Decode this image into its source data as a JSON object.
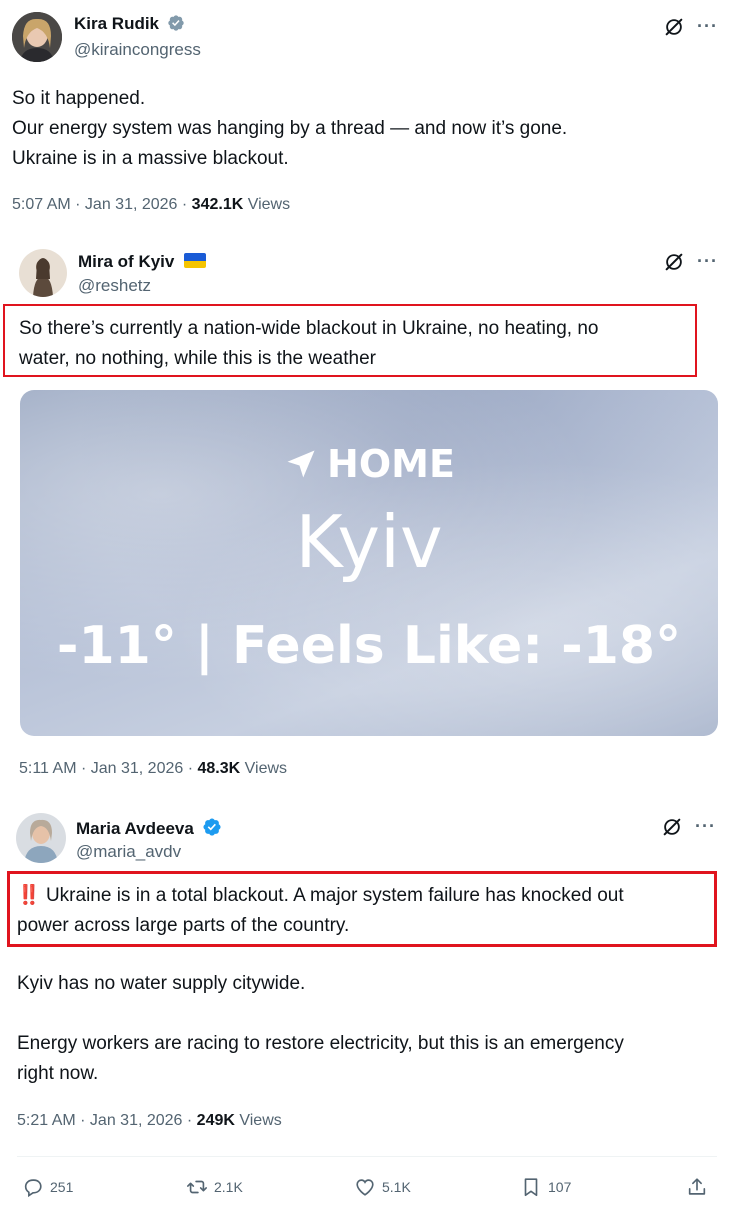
{
  "tweet1": {
    "name": "Kira Rudik",
    "handle": "@kiraincongress",
    "lines": [
      "So it happened.",
      "Our energy system was hanging by a thread — and now it’s gone.",
      "Ukraine is in a massive blackout."
    ],
    "time": "5:07 AM · Jan 31, 2026 · ",
    "views_count": "342.1K",
    "views_label": " Views"
  },
  "tweet2": {
    "name": "Mira of Kyiv",
    "flag": "🇺🇦",
    "handle": "@reshetz",
    "lines": [
      "So there’s currently a nation-wide blackout in Ukraine, no heating, no",
      "water, no nothing, while this is the weather"
    ],
    "weather": {
      "location_label": "HOME",
      "city": "Kyiv",
      "temp_line": "-11° | Feels Like: -18°"
    },
    "time": "5:11 AM · Jan 31, 2026 · ",
    "views_count": "48.3K",
    "views_label": " Views"
  },
  "tweet3": {
    "name": "Maria Avdeeva",
    "handle": "@maria_avdv",
    "alert_emoji": "‼️",
    "highlight_lines": [
      " Ukraine is in a total blackout. A major system failure has knocked out",
      "power across large parts of the country."
    ],
    "para2": "Kyiv has no water supply citywide.",
    "para3_lines": [
      "Energy workers are racing to restore electricity, but this is an emergency",
      "right now."
    ],
    "time": "5:21 AM · Jan 31, 2026 · ",
    "views_count": "249K",
    "views_label": " Views",
    "actions": {
      "replies": "251",
      "reposts": "2.1K",
      "likes": "5.1K",
      "bookmarks": "107"
    }
  },
  "icons": {
    "verified": "verified-badge-icon",
    "grok": "grok-icon",
    "more": "more-icon"
  },
  "colors": {
    "verified_blue": "#1d9bf0",
    "highlight_red": "#e0141e",
    "secondary_text": "#536471"
  },
  "more_label": "···"
}
